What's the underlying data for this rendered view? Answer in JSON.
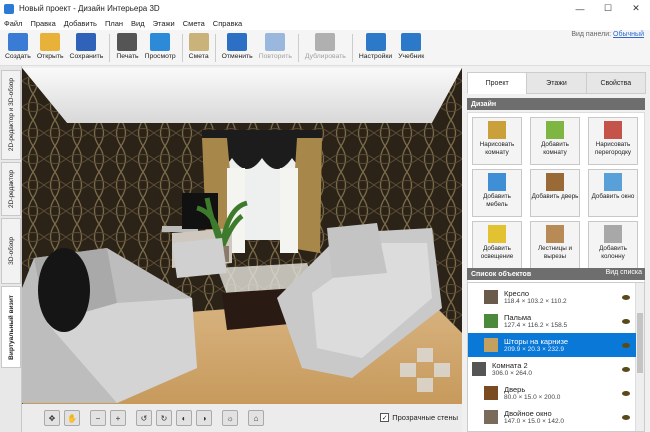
{
  "window": {
    "title": "Новый проект - Дизайн Интерьера 3D"
  },
  "menu": [
    "Файл",
    "Правка",
    "Добавить",
    "План",
    "Вид",
    "Этажи",
    "Смета",
    "Справка"
  ],
  "view_panel": {
    "label": "Вид панели:",
    "value": "Обычный"
  },
  "toolbar": [
    {
      "label": "Создать",
      "icon": "new-file-icon",
      "color": "#3a7bd5"
    },
    {
      "label": "Открыть",
      "icon": "folder-icon",
      "color": "#e8b23a"
    },
    {
      "label": "Сохранить",
      "icon": "save-icon",
      "color": "#2f62b8"
    },
    {
      "label": "Печать",
      "icon": "printer-icon",
      "color": "#555555"
    },
    {
      "label": "Просмотр",
      "icon": "monitor-icon",
      "color": "#2d8ad8"
    },
    {
      "label": "Смета",
      "icon": "estimate-icon",
      "color": "#c9b37a"
    },
    {
      "label": "Отменить",
      "icon": "undo-icon",
      "color": "#2d6fc4"
    },
    {
      "label": "Повторить",
      "icon": "redo-icon",
      "color": "#9ab7de",
      "disabled": true
    },
    {
      "label": "Дублировать",
      "icon": "duplicate-icon",
      "color": "#b0b0b0",
      "disabled": true
    },
    {
      "label": "Настройки",
      "icon": "gear-icon",
      "color": "#2d79c9"
    },
    {
      "label": "Учебник",
      "icon": "help-icon",
      "color": "#2d79c9"
    }
  ],
  "side_tabs": [
    "2D-редактор и 3D-обзор",
    "2D-редактор",
    "3D-обзор",
    "Виртуальный визит"
  ],
  "right_tabs": [
    "Проект",
    "Этажи",
    "Свойства"
  ],
  "design_header": "Дизайн",
  "design_buttons": [
    {
      "label": "Нарисовать комнату",
      "icon": "draw-room-icon",
      "color": "#c9a03a"
    },
    {
      "label": "Добавить комнату",
      "icon": "add-room-icon",
      "color": "#7fb542"
    },
    {
      "label": "Нарисовать перегородку",
      "icon": "partition-icon",
      "color": "#c4544a"
    },
    {
      "label": "Добавить мебель",
      "icon": "furniture-icon",
      "color": "#3f8fd6"
    },
    {
      "label": "Добавить дверь",
      "icon": "door-icon",
      "color": "#9a6a36"
    },
    {
      "label": "Добавить окно",
      "icon": "window-icon",
      "color": "#5aa0d8"
    },
    {
      "label": "Добавить освещение",
      "icon": "lamp-icon",
      "color": "#e2c230"
    },
    {
      "label": "Лестницы и вырезы",
      "icon": "stairs-icon",
      "color": "#b88a56"
    },
    {
      "label": "Добавить колонну",
      "icon": "column-icon",
      "color": "#a8a8a8"
    }
  ],
  "objects_header": "Список объектов",
  "list_view_link": "Вид списка",
  "objects": [
    {
      "name": "Кресло",
      "dims": "118.4 × 103.2 × 110.2",
      "icon": "armchair-icon",
      "color": "#6a5a4a",
      "indent": true
    },
    {
      "name": "Пальма",
      "dims": "127.4 × 116.2 × 158.5",
      "icon": "palm-icon",
      "color": "#4b8a3a",
      "indent": true
    },
    {
      "name": "Шторы на карнизе",
      "dims": "209.9 × 20.3 × 232.9",
      "icon": "curtains-icon",
      "color": "#c2a060",
      "indent": true,
      "selected": true
    },
    {
      "name": "Комната 2",
      "dims": "306.0 × 264.0",
      "icon": "room-icon",
      "color": "#555555",
      "indent": false
    },
    {
      "name": "Дверь",
      "dims": "80.0 × 15.0 × 200.0",
      "icon": "door-icon",
      "color": "#7a4a22",
      "indent": true
    },
    {
      "name": "Двойное окно",
      "dims": "147.0 × 15.0 × 142.0",
      "icon": "window-icon",
      "color": "#7a6a5a",
      "indent": true
    }
  ],
  "bottom_buttons": [
    "move-icon",
    "hand-icon",
    "zoom-out-icon",
    "zoom-in-icon",
    "rotate-left-icon",
    "rotate-right-icon",
    "orbit-left-icon",
    "orbit-right-icon",
    "light-icon",
    "home-icon"
  ],
  "transparent_walls": {
    "label": "Прозрачные стены",
    "checked": true
  }
}
